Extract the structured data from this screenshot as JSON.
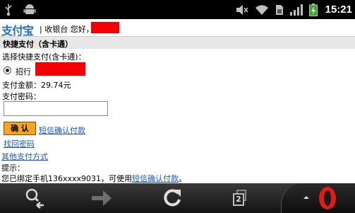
{
  "status_bar": {
    "time": "15:21",
    "icons": [
      "usb-icon",
      "android-icon",
      "mute-icon",
      "wifi-icon",
      "sim-icon",
      "signal-icon",
      "battery-icon"
    ]
  },
  "page": {
    "logo": "支付宝",
    "header_text": "| 收银台 您好，",
    "section_title": "快捷支付（含卡通）",
    "choose_label": "选择快捷支付(含卡通)：",
    "card_label": "招行",
    "amount_label": "支付金额：29.74元",
    "password_label": "支付密码：",
    "password_value": "",
    "confirm_label": "确 认",
    "sms_link": "短信确认付款",
    "find_password_link": "找回密码",
    "other_methods_link": "其他支付方式",
    "tip_title": "提示：",
    "tip_text": "您已绑定手机136xxxx9031，可使用",
    "tip_link": "短信确认付款",
    "tip_end": "。",
    "redact_color": "#f40000",
    "link_color": "#1a55c2",
    "button_color": "#f7a51f"
  },
  "toolbar": {
    "tab_count": "2",
    "icons": [
      "zoom-back-icon",
      "forward-icon",
      "reload-icon",
      "tabs-icon",
      "opera-menu-icon"
    ]
  }
}
